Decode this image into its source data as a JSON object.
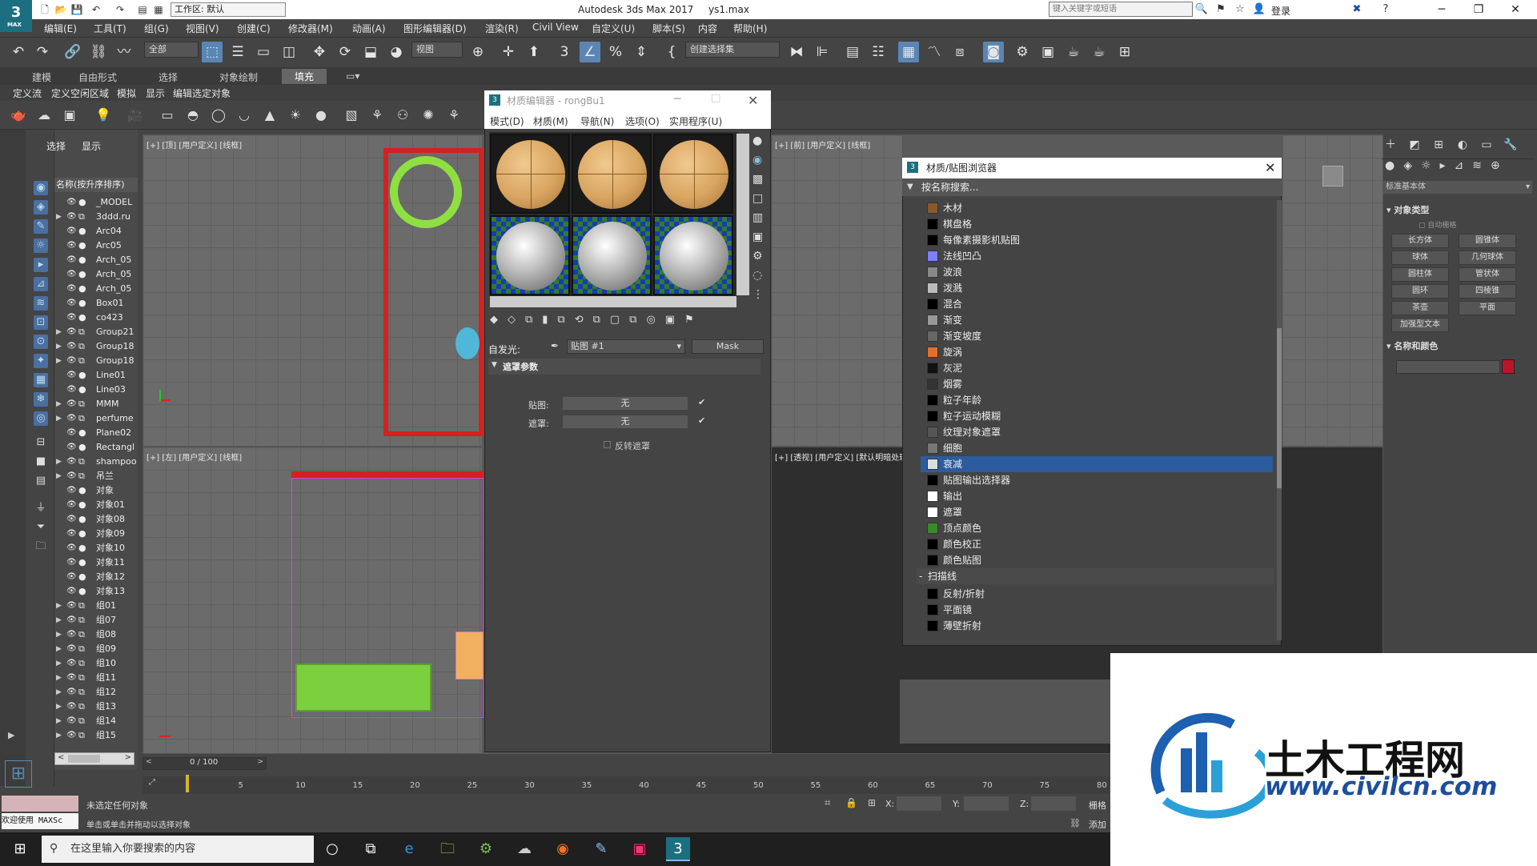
{
  "app": {
    "title": "Autodesk 3ds Max 2017",
    "file": "ys1.max",
    "logo_text": "3",
    "logo_sub": "MAX",
    "workspace": "工作区: 默认",
    "search_placeholder": "键入关键字或短语",
    "login": "登录"
  },
  "menu": [
    "编辑(E)",
    "工具(T)",
    "组(G)",
    "视图(V)",
    "创建(C)",
    "修改器(M)",
    "动画(A)",
    "图形编辑器(D)",
    "渲染(R)",
    "Civil View",
    "自定义(U)",
    "脚本(S)",
    "内容",
    "帮助(H)"
  ],
  "toolbar": {
    "filter": "全部",
    "view": "视图",
    "selection_set": "创建选择集"
  },
  "ribbon": {
    "tabs": [
      "建模",
      "自由形式",
      "选择",
      "对象绘制",
      "填充"
    ],
    "active": "填充",
    "subtabs": [
      "定义流",
      "定义空闲区域",
      "模拟",
      "显示",
      "编辑选定对象"
    ]
  },
  "explorer": {
    "tabs": [
      "选择",
      "显示"
    ],
    "sort_header": "名称(按升序排序)",
    "rows": [
      {
        "name": "_MODEL",
        "exp": false
      },
      {
        "name": "3ddd.ru",
        "exp": true
      },
      {
        "name": "Arc04",
        "exp": false
      },
      {
        "name": "Arc05",
        "exp": false
      },
      {
        "name": "Arch_05",
        "exp": false
      },
      {
        "name": "Arch_05",
        "exp": false
      },
      {
        "name": "Arch_05",
        "exp": false
      },
      {
        "name": "Box01",
        "exp": false
      },
      {
        "name": "co423",
        "exp": false
      },
      {
        "name": "Group21",
        "exp": true
      },
      {
        "name": "Group18",
        "exp": true
      },
      {
        "name": "Group18",
        "exp": true
      },
      {
        "name": "Line01",
        "exp": false
      },
      {
        "name": "Line03",
        "exp": false
      },
      {
        "name": "MMM",
        "exp": true
      },
      {
        "name": "perfume",
        "exp": true
      },
      {
        "name": "Plane02",
        "exp": false
      },
      {
        "name": "Rectangl",
        "exp": false
      },
      {
        "name": "shampoo",
        "exp": true
      },
      {
        "name": "吊兰",
        "exp": true
      },
      {
        "name": "对象",
        "exp": false
      },
      {
        "name": "对象01",
        "exp": false
      },
      {
        "name": "对象08",
        "exp": false
      },
      {
        "name": "对象09",
        "exp": false
      },
      {
        "name": "对象10",
        "exp": false
      },
      {
        "name": "对象11",
        "exp": false
      },
      {
        "name": "对象12",
        "exp": false
      },
      {
        "name": "对象13",
        "exp": false
      },
      {
        "name": "组01",
        "exp": true
      },
      {
        "name": "组07",
        "exp": true
      },
      {
        "name": "组08",
        "exp": true
      },
      {
        "name": "组09",
        "exp": true
      },
      {
        "name": "组10",
        "exp": true
      },
      {
        "name": "组11",
        "exp": true
      },
      {
        "name": "组12",
        "exp": true
      },
      {
        "name": "组13",
        "exp": true
      },
      {
        "name": "组14",
        "exp": true
      },
      {
        "name": "组15",
        "exp": true
      }
    ]
  },
  "viewports": {
    "top": "[+] [顶] [用户定义] [线框]",
    "left": "[+] [左] [用户定义] [线框]",
    "front": "[+] [前] [用户定义] [线框]",
    "persp": "[+] [透视] [用户定义] [默认明暗处理]"
  },
  "material_editor": {
    "title": "材质编辑器 - rongBu1",
    "menu": [
      "模式(D)",
      "材质(M)",
      "导航(N)",
      "选项(O)",
      "实用程序(U)"
    ],
    "selfillum_label": "自发光:",
    "map_dropdown": "贴图 #1",
    "map_type_button": "Mask",
    "rollout_title": "遮罩参数",
    "map_label": "贴图:",
    "mask_label": "遮罩:",
    "map_value": "无",
    "mask_value": "无",
    "invert_label": "反转遮罩"
  },
  "mat_browser": {
    "title": "材质/贴图浏览器",
    "search": "按名称搜索...",
    "items": [
      {
        "name": "木材",
        "sw": "#8b5a2b"
      },
      {
        "name": "棋盘格",
        "sw": "#000"
      },
      {
        "name": "每像素摄影机贴图",
        "sw": "#000"
      },
      {
        "name": "法线凹凸",
        "sw": "#7f7fff"
      },
      {
        "name": "波浪",
        "sw": "#888"
      },
      {
        "name": "泼溅",
        "sw": "#bbb"
      },
      {
        "name": "混合",
        "sw": "#000"
      },
      {
        "name": "渐变",
        "sw": "#999"
      },
      {
        "name": "渐变坡度",
        "sw": "#666"
      },
      {
        "name": "旋涡",
        "sw": "#e07030"
      },
      {
        "name": "灰泥",
        "sw": "#111"
      },
      {
        "name": "烟雾",
        "sw": "#333"
      },
      {
        "name": "粒子年龄",
        "sw": "#000"
      },
      {
        "name": "粒子运动模糊",
        "sw": "#000"
      },
      {
        "name": "纹理对象遮罩",
        "sw": "#555"
      },
      {
        "name": "细胞",
        "sw": "#777"
      },
      {
        "name": "衰减",
        "sw": "#ddd"
      },
      {
        "name": "贴图输出选择器",
        "sw": "#000"
      },
      {
        "name": "输出",
        "sw": "#fff"
      },
      {
        "name": "遮罩",
        "sw": "#fff"
      },
      {
        "name": "顶点颜色",
        "sw": "#3a8a2a"
      },
      {
        "name": "颜色校正",
        "sw": "#000"
      },
      {
        "name": "颜色贴图",
        "sw": "#000"
      }
    ],
    "selected": "衰减",
    "section": "扫描线",
    "section_items": [
      {
        "name": "反射/折射",
        "sw": "#000"
      },
      {
        "name": "平面镜",
        "sw": "#000"
      },
      {
        "name": "薄壁折射",
        "sw": "#000"
      }
    ]
  },
  "command_panel": {
    "dropdown": "标准基本体",
    "section1": "对象类型",
    "autogrid": "自动栅格",
    "buttons": [
      "长方体",
      "圆锥体",
      "球体",
      "几何球体",
      "圆柱体",
      "管状体",
      "圆环",
      "四棱锥",
      "茶壶",
      "平面",
      "加强型文本"
    ],
    "section2": "名称和颜色",
    "color": "#b8162a"
  },
  "timeline": {
    "frame": "0 / 100",
    "ticks": [
      "5",
      "10",
      "15",
      "20",
      "25",
      "30",
      "35",
      "40",
      "45",
      "50",
      "55",
      "60",
      "65",
      "70",
      "75",
      "80"
    ],
    "slider_value": 0
  },
  "status": {
    "welcome": "欢迎使用 MAXSc",
    "msg1": "未选定任何对象",
    "msg2": "单击或单击并拖动以选择对象",
    "x": "X:",
    "y": "Y:",
    "z": "Z:",
    "grid": "栅格",
    "add": "添加"
  },
  "taskbar": {
    "search": "在这里输入你要搜索的内容"
  },
  "watermark": {
    "brand": "土木工程网",
    "url": "www.civilcn.com"
  }
}
